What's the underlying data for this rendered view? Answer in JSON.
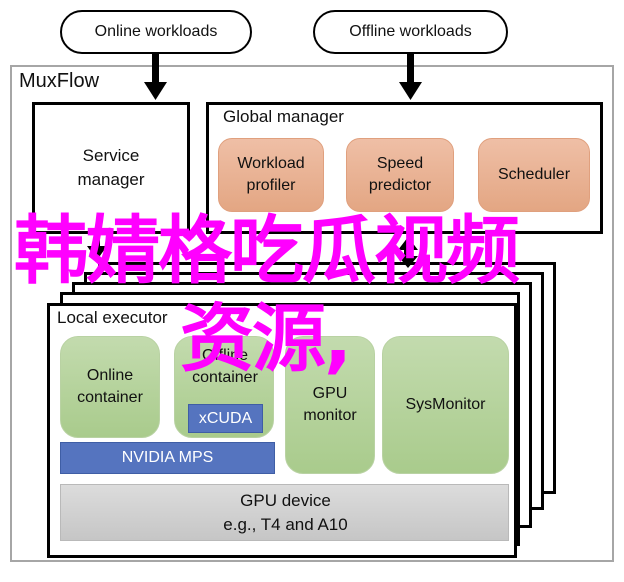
{
  "inputs": {
    "online_workloads": "Online workloads",
    "offline_workloads": "Offline workloads"
  },
  "system": {
    "name": "MuxFlow",
    "service_manager": "Service manager",
    "global_manager": {
      "title": "Global manager",
      "components": [
        "Workload profiler",
        "Speed predictor",
        "Scheduler"
      ]
    },
    "local_executor": {
      "title": "Local executor",
      "online_container": "Online container",
      "offline_container": "Offline container",
      "xcuda": "xCUDA",
      "nvidia_mps": "NVIDIA MPS",
      "gpu_monitor": "GPU monitor",
      "sysmonitor": "SysMonitor",
      "gpu_device_line1": "GPU device",
      "gpu_device_line2": "e.g., T4 and A10"
    }
  },
  "overlay": {
    "line1": "韩婧格吃瓜视频",
    "line2": "资源,"
  },
  "colors": {
    "overlay": "#ff00ff",
    "orange_box": "#e9b093",
    "green_box": "#b5d39b",
    "blue_box": "#5574bf",
    "gray_box": "#cfcfcf",
    "outer_border": "#a6a6a6"
  }
}
